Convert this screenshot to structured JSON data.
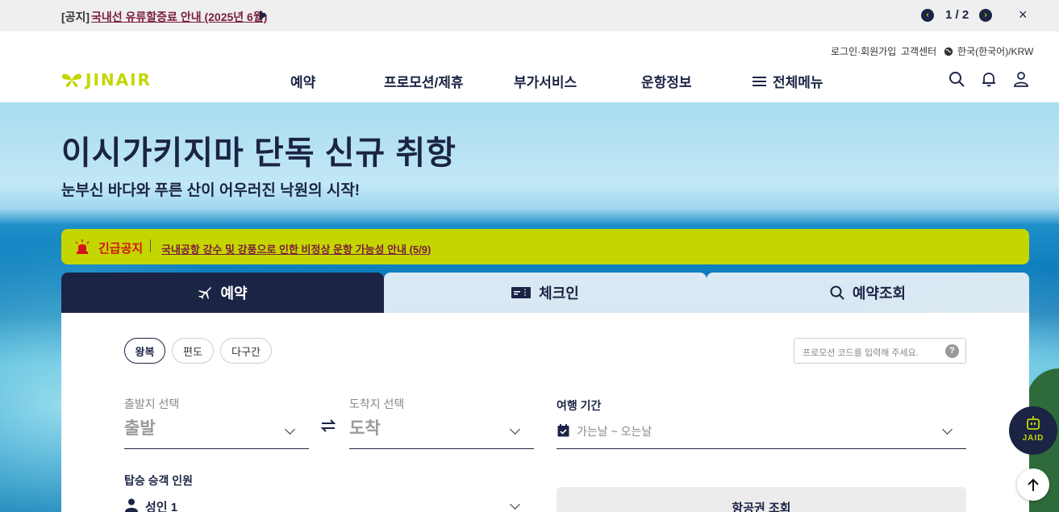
{
  "notice": {
    "prefix": "[공지]",
    "link": "국내선 유류할증료 안내 (2025년 6월)",
    "pager": "1 / 2",
    "close": "×"
  },
  "header": {
    "util": [
      "로그인·회원가입",
      "고객센터",
      "한국(한국어)/KRW"
    ],
    "logo": "JINAIR",
    "nav": [
      "예약",
      "프로모션/제휴",
      "부가서비스",
      "운항정보",
      "전체메뉴"
    ]
  },
  "hero": {
    "title": "이시가키지마 단독 신규 취항",
    "subtitle": "눈부신 바다와 푸른 산이 어우러진 낙원의 시작!"
  },
  "alert": {
    "label": "긴급공지",
    "text": "국내공항 강수 및 강풍으로 인한 비정상 운항 가능성 안내 (5/9)"
  },
  "tabs": [
    "예약",
    "체크인",
    "예약조회"
  ],
  "booking": {
    "trip_types": [
      "왕복",
      "편도",
      "다구간"
    ],
    "promo_placeholder": "프로모션 코드를 입력해 주세요.",
    "promo_help": "?",
    "origin_label": "출발지 선택",
    "origin_value": "출발",
    "dest_label": "도착지 선택",
    "dest_value": "도착",
    "period_label": "여행 기간",
    "period_placeholder": "가는날 ~ 오는날",
    "passenger_label": "탑승 승객 인원",
    "passenger_value": "성인 1",
    "search_button": "항공권 조회"
  },
  "chatbot_label": "JAID",
  "colors": {
    "navy": "#1b2445",
    "lime": "#c4d600",
    "alert_red": "#d4141c",
    "notice_link": "#7a1d3e"
  }
}
